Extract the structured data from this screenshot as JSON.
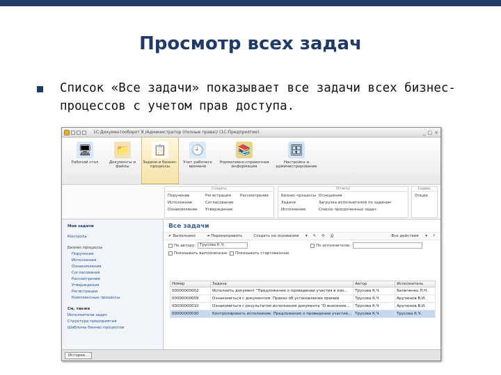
{
  "slide": {
    "title": "Просмотр всех задач",
    "bullet_text": "Список «Все задачи» показывает все задачи всех бизнес-процессов с учетом прав доступа."
  },
  "window": {
    "title": "1С:Документооборот 8 /Администратор (полные права)/ (1С:Предприятие)"
  },
  "sections": [
    {
      "label": "Рабочий стол",
      "icon": "desk-icon"
    },
    {
      "label": "Документы и файлы",
      "icon": "documents-icon"
    },
    {
      "label": "Задачи и бизнес-процессы",
      "icon": "tasks-icon"
    },
    {
      "label": "Учет рабочего времени",
      "icon": "clock-icon"
    },
    {
      "label": "Нормативно-справочная информация",
      "icon": "reference-icon"
    },
    {
      "label": "Настройка и администрирование",
      "icon": "admin-icon"
    }
  ],
  "commands": {
    "group_create": "Создать",
    "col1": [
      "Поручение",
      "Исполнение",
      "Ознакомление"
    ],
    "col2": [
      "Регистрация",
      "Согласование",
      "Утверждение"
    ],
    "col3": [
      "Рассмотрение",
      "",
      ""
    ],
    "group_reports": "Отчеты",
    "col4": [
      "Бизнес-процессы",
      "Задачи",
      "Исполнения"
    ],
    "col5": [
      "Отношения",
      "Загрузка исполнителей по задачам",
      "Список просроченных задач"
    ],
    "group_service": "Сервис",
    "col6": [
      "Опции"
    ]
  },
  "nav": {
    "heading": "Мои задачи",
    "top": [
      "Контроль"
    ],
    "group_heading": "Бизнес-процессы",
    "items": [
      "Поручения",
      "Исполнения",
      "Ознакомления",
      "Согласования",
      "Рассмотрения",
      "Утверждения",
      "Регистрации",
      "Комплексные процессы"
    ],
    "see_also": "См. также",
    "links": [
      "Исполнители задач",
      "Структура предприятия",
      "Шаблоны бизнес-процессов"
    ]
  },
  "work": {
    "title": "Все задачи",
    "toolbar": [
      "Выполнено",
      "Перенаправить",
      "Создать на основании",
      "Все действия"
    ],
    "filter_author_label": "По автору",
    "filter_author_value": "Трусова К.Ч.",
    "filter_executor_label": "По исполнителю",
    "show_completed": "Показывать выполненные",
    "show_started": "Показывать стартованные"
  },
  "table": {
    "headers": [
      "Номер",
      "Задача",
      "Автор",
      "Исполнитель"
    ],
    "rows": [
      [
        "00000000002",
        "Исполнить документ \"Предложение о проведении участия в кон...",
        "Трусова К.Ч.",
        "Беличенко Л.Н."
      ],
      [
        "00000000009",
        "Ознакомиться с документом. Приказ об установлении премии",
        "Трусова К.Ч.",
        "Арутюнов В.И."
      ],
      [
        "00000000010",
        "Ознакомиться с результатом исполнения документа \"О внесении...",
        "Трусова К.Ч.",
        "Арутюнов В.И."
      ],
      [
        "00000000030",
        "Контролировать исполнение. Предложение о проведении участия...",
        "Трусова К.Ч.",
        "Трусова К.Ч."
      ]
    ]
  },
  "statusbar": {
    "history_label": "История..."
  }
}
